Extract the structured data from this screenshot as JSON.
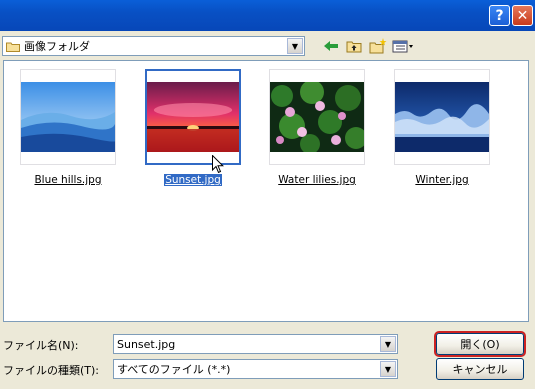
{
  "titlebar": {
    "help_label": "?",
    "close_label": "✕"
  },
  "toolbar": {
    "look_in_value": "画像フォルダ",
    "icons": [
      "back-icon",
      "up-folder-icon",
      "new-folder-icon",
      "view-menu-icon"
    ]
  },
  "files": [
    {
      "name": "Blue hills.jpg",
      "selected": false
    },
    {
      "name": "Sunset.jpg",
      "selected": true
    },
    {
      "name": "Water lilies.jpg",
      "selected": false
    },
    {
      "name": "Winter.jpg",
      "selected": false
    }
  ],
  "form": {
    "filename_label": "ファイル名(N):",
    "filename_value": "Sunset.jpg",
    "filetype_label": "ファイルの種類(T):",
    "filetype_value": "すべてのファイル (*.*)"
  },
  "buttons": {
    "open_label": "開く(O)",
    "cancel_label": "キャンセル"
  },
  "colors": {
    "selection": "#316ac5",
    "default_ring": "#cc2222",
    "titlebar": "#0850c4"
  }
}
